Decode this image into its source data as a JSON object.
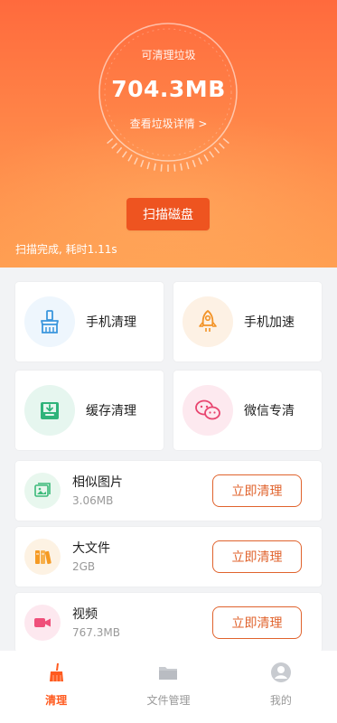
{
  "hero": {
    "ring_title": "可清理垃圾",
    "junk_size": "704.3MB",
    "detail_link": "查看垃圾详情 >",
    "scan_button": "扫描磁盘",
    "scan_status": "扫描完成, 耗时1.11s"
  },
  "features": [
    {
      "label": "手机清理",
      "icon": "broom-icon"
    },
    {
      "label": "手机加速",
      "icon": "rocket-icon"
    },
    {
      "label": "缓存清理",
      "icon": "inbox-download-icon"
    },
    {
      "label": "微信专清",
      "icon": "wechat-icon"
    }
  ],
  "clean_items": [
    {
      "name": "相似图片",
      "size": "3.06MB",
      "action": "立即清理",
      "icon": "image-icon",
      "color": "#3cba7a"
    },
    {
      "name": "大文件",
      "size": "2GB",
      "action": "立即清理",
      "icon": "books-icon",
      "color": "#f59a23"
    },
    {
      "name": "视频",
      "size": "767.3MB",
      "action": "立即清理",
      "icon": "video-icon",
      "color": "#ef4f7a"
    }
  ],
  "tabs": [
    {
      "label": "清理",
      "active": true
    },
    {
      "label": "文件管理",
      "active": false
    },
    {
      "label": "我的",
      "active": false
    }
  ],
  "colors": {
    "accent": "#ff5a1f",
    "button_border": "#e0632d"
  }
}
